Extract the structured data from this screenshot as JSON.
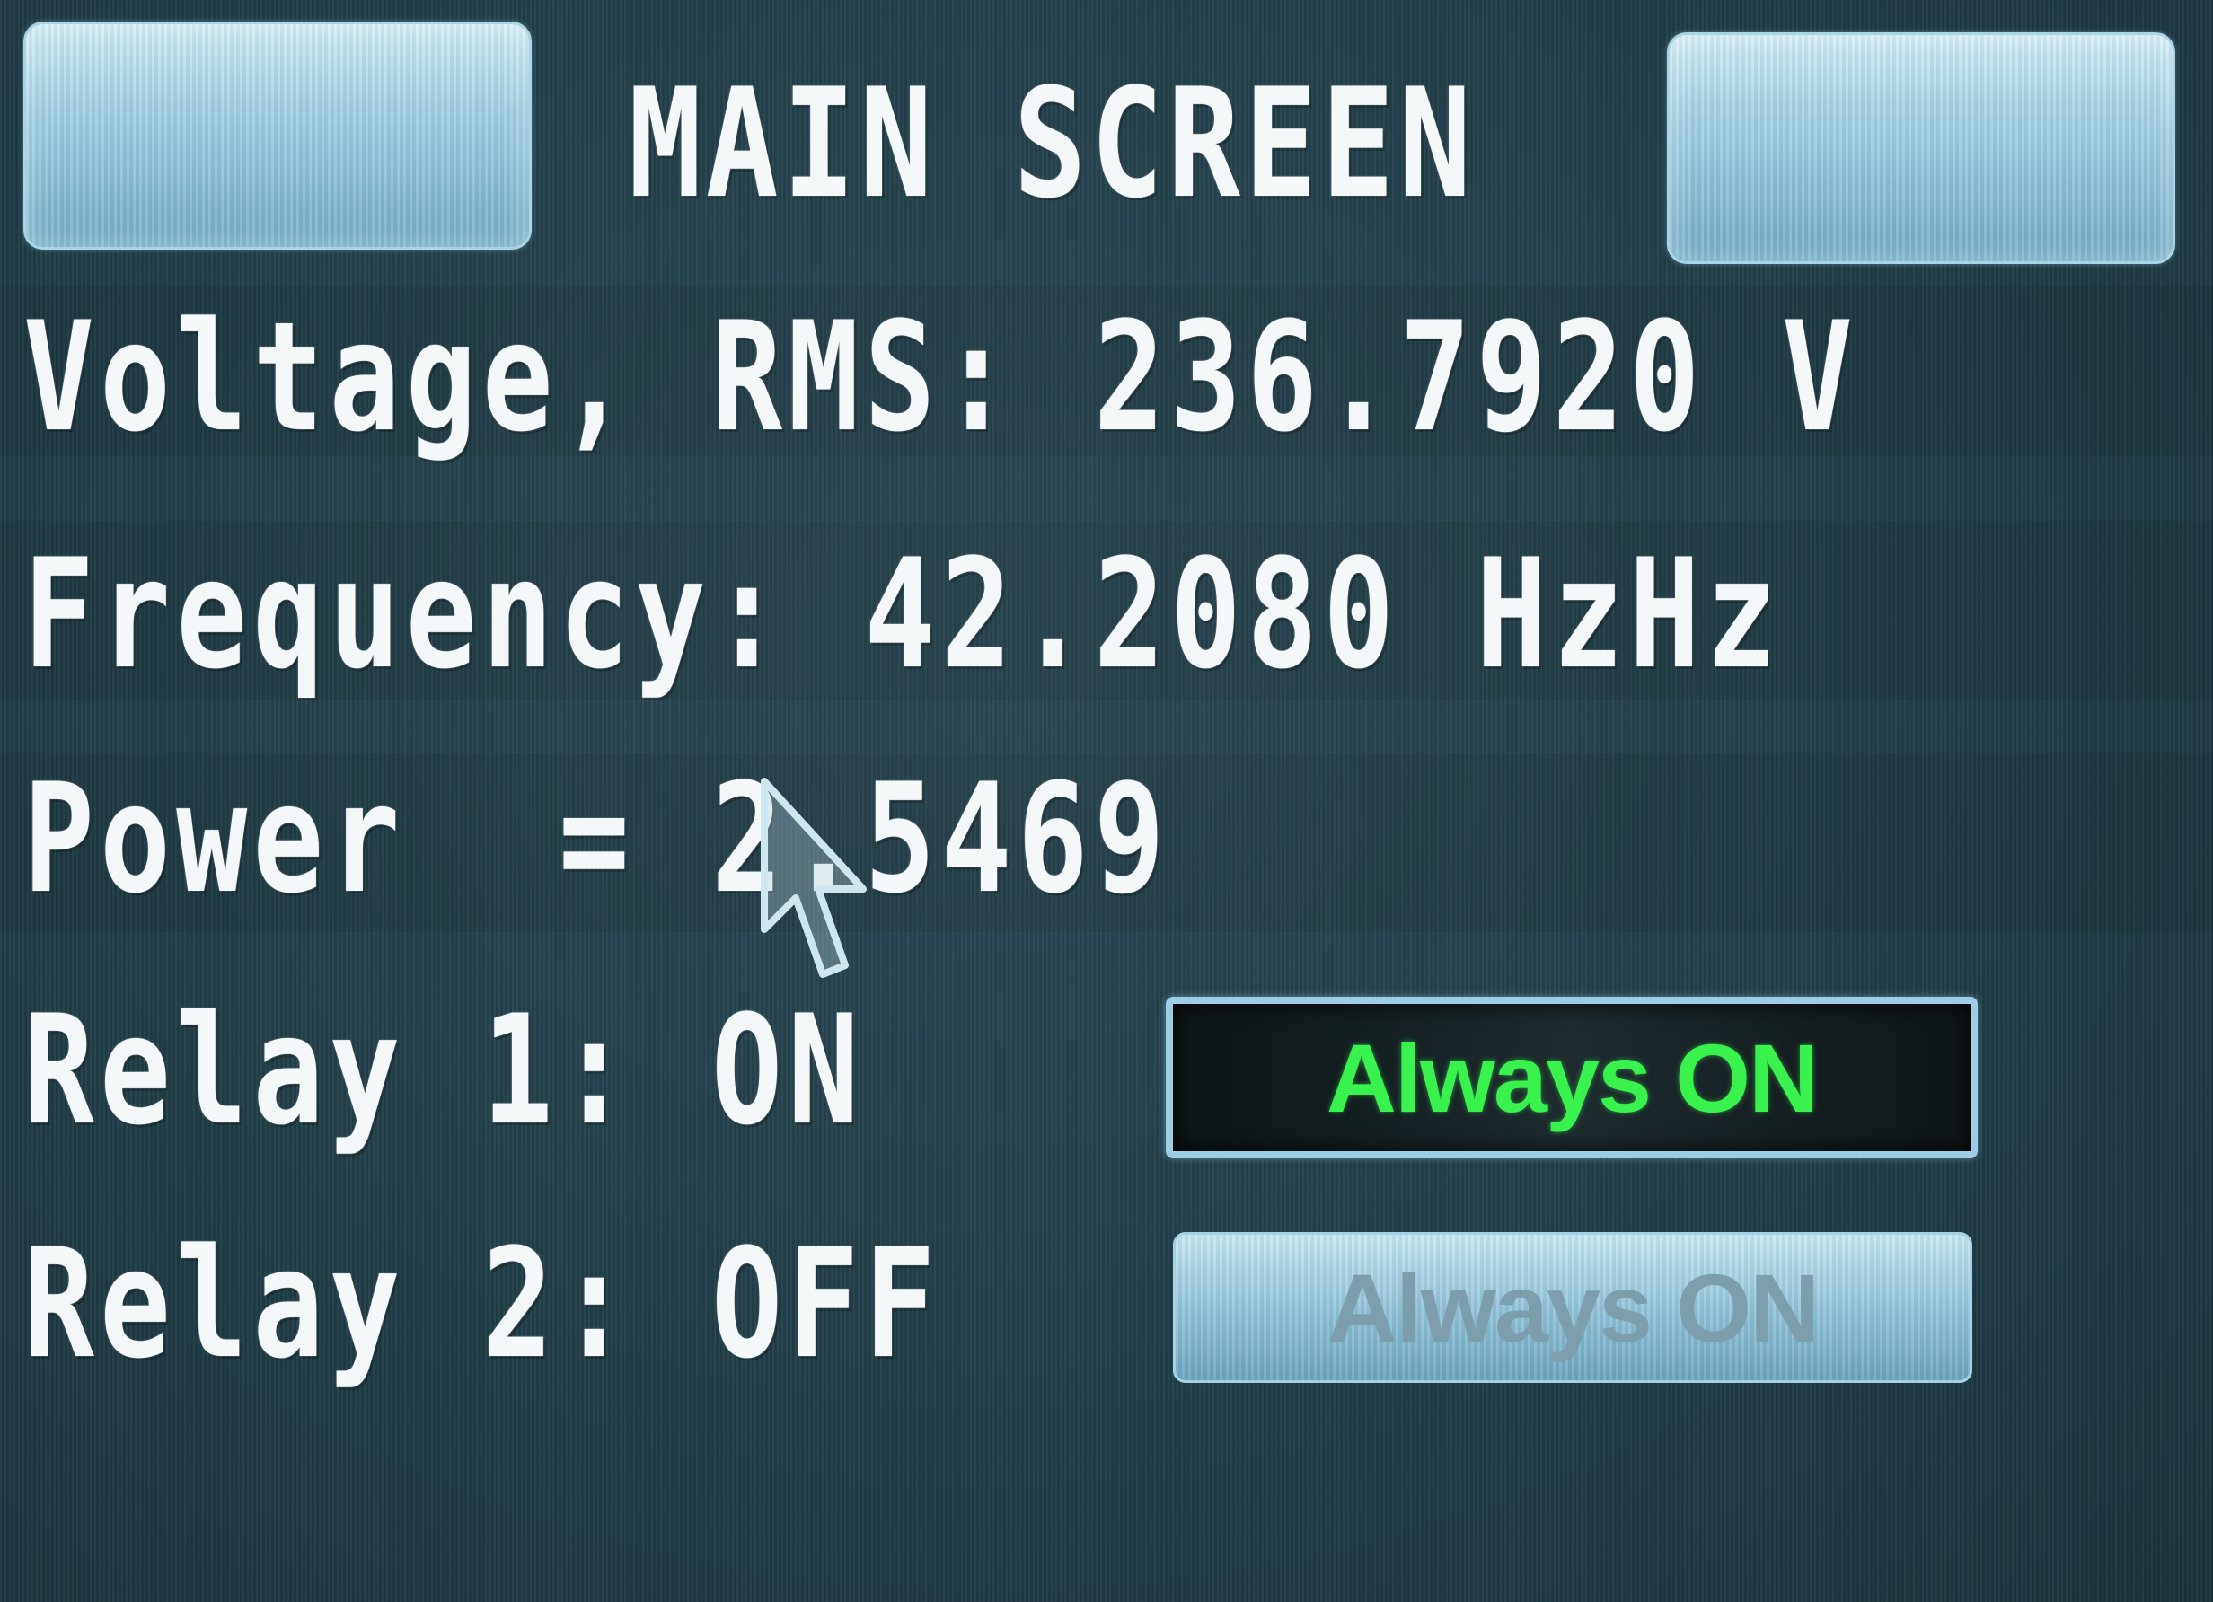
{
  "header": {
    "title": "MAIN SCREEN",
    "left_button_label": "",
    "right_button_label": ""
  },
  "readings": {
    "voltage": "Voltage, RMS: 236.7920 V",
    "frequency": "Frequency: 42.2080 HzHz",
    "power": "Power  = 2.5469"
  },
  "relays": [
    {
      "status": "Relay 1: ON",
      "button_label": "Always ON",
      "button_state": "active"
    },
    {
      "status": "Relay 2: OFF",
      "button_label": "Always ON",
      "button_state": "inactive"
    }
  ],
  "colors": {
    "background": "#223e48",
    "text": "#f4f8f8",
    "active_button_text": "#39f24e",
    "inactive_button_text": "#7f9eab",
    "button_face": "#9ccde0"
  },
  "icons": {
    "pointer": "arrow-cursor-icon"
  }
}
